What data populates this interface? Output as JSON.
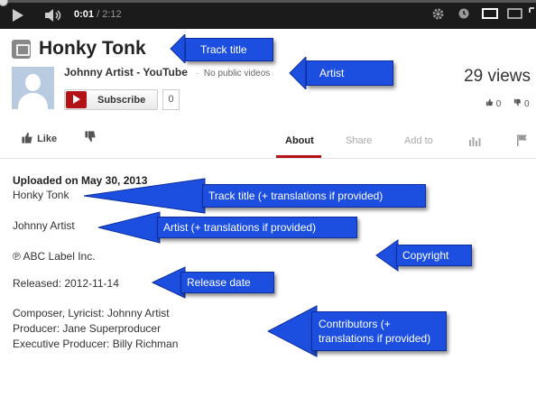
{
  "player": {
    "current_time": "0:01",
    "duration": "/ 2:12",
    "progress_fraction": 0.008
  },
  "header": {
    "title": "Honky Tonk",
    "channel_name": "Johnny Artist  - YouTube",
    "dot": "·",
    "no_public_videos": "No public videos",
    "subscribe_label": "Subscribe",
    "subscriber_count": "0",
    "views": "29 views",
    "likes": "0",
    "dislikes": "0"
  },
  "actions": {
    "like_label": "Like",
    "tabs": [
      {
        "label": "About",
        "active": true
      },
      {
        "label": "Share",
        "active": false
      },
      {
        "label": "Add to",
        "active": false
      }
    ]
  },
  "description": {
    "uploaded": "Uploaded on May 30, 2013",
    "track_title": "Honky Tonk",
    "artist": "Johnny Artist",
    "copyright": "℗ ABC Label Inc.",
    "released": "Released: 2012-11-14",
    "composer": "Composer, Lyricist: Johnny Artist",
    "producer": "Producer: Jane Superproducer",
    "exec_producer": "Executive Producer: Billy Richman"
  },
  "annotations": {
    "track_title": "Track title",
    "artist": "Artist",
    "track_title_desc": "Track title (+ translations if provided)",
    "artist_desc": "Artist (+ translations if provided)",
    "copyright": "Copyright",
    "release_date": "Release date",
    "contributors_line1": "Contributors (+",
    "contributors_line2": "translations if provided)"
  },
  "colors": {
    "annotation_blue": "#1c4fe0",
    "youtube_red": "#b31217",
    "player_bg": "#1b1b1b"
  }
}
